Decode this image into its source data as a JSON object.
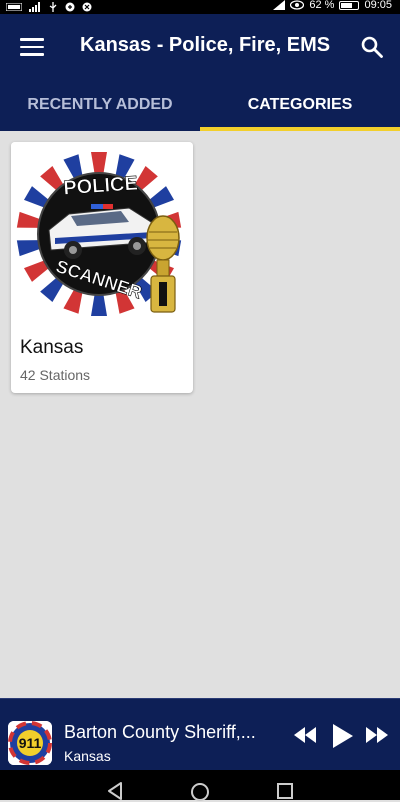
{
  "status_bar": {
    "battery_percent": "62 %",
    "time": "09:05",
    "icons": [
      "carrier-icon",
      "signal-icon",
      "usb-icon",
      "notification-icon",
      "notification-icon",
      "signal-icon",
      "eye-icon",
      "battery-icon"
    ]
  },
  "app_bar": {
    "title": "Kansas - Police, Fire, EMS",
    "menu_icon": "menu-icon",
    "search_icon": "search-icon",
    "background_color": "#0d1f56",
    "accent_color": "#f2cf2b"
  },
  "tabs": [
    {
      "label": "RECENTLY ADDED",
      "active": false
    },
    {
      "label": "CATEGORIES",
      "active": true
    }
  ],
  "categories": [
    {
      "name": "Kansas",
      "stations": "42 Stations",
      "image": "police-scanner-logo"
    }
  ],
  "player": {
    "title": "Barton County Sheriff,...",
    "subtitle": "Kansas",
    "logo": "911-logo",
    "logo_text": "911",
    "controls": [
      "rewind-icon",
      "play-icon",
      "fast-forward-icon"
    ]
  },
  "nav_bar": {
    "buttons": [
      "back-icon",
      "home-icon",
      "recents-icon"
    ]
  }
}
